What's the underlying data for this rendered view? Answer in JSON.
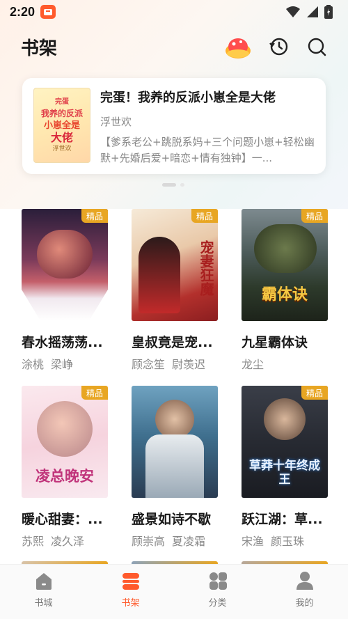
{
  "status_bar": {
    "time": "2:20"
  },
  "header": {
    "title": "书架",
    "icons": [
      "gift-icon",
      "history-icon",
      "search-icon"
    ]
  },
  "featured": {
    "title": "完蛋！我养的反派小崽全是大佬",
    "author": "浮世欢",
    "description": "【爹系老公+跳脱系妈+三个问题小崽+轻松幽默+先婚后爱+暗恋+情有独钟】一...",
    "cover_text": [
      "完蛋",
      "我养的反派",
      "小崽全是",
      "大佬"
    ],
    "cover_author": "浮世欢"
  },
  "badge_label": "精品",
  "books": [
    {
      "title": "春水摇荡荡...",
      "authors": [
        "涂桃",
        "梁峥"
      ],
      "badge": true
    },
    {
      "title": "皇叔竟是宠...",
      "authors": [
        "顾念笙",
        "尉羡迟"
      ],
      "badge": true,
      "cover_text": "宠妻狂魔"
    },
    {
      "title": "九星霸体诀",
      "authors": [
        "龙尘"
      ],
      "badge": true,
      "cover_text": "霸体诀"
    },
    {
      "title": "暖心甜妻：...",
      "authors": [
        "苏熙",
        "凌久泽"
      ],
      "badge": true,
      "cover_text": "凌总晚安"
    },
    {
      "title": "盛景如诗不歇",
      "authors": [
        "顾崇高",
        "夏凌霜"
      ],
      "badge": false
    },
    {
      "title": "跃江湖：草...",
      "authors": [
        "宋渔",
        "颜玉珠"
      ],
      "badge": true,
      "cover_text": "草莽十年终成王"
    }
  ],
  "tabs": [
    {
      "label": "书城",
      "icon": "home-icon",
      "active": false
    },
    {
      "label": "书架",
      "icon": "bookshelf-icon",
      "active": true
    },
    {
      "label": "分类",
      "icon": "category-icon",
      "active": false
    },
    {
      "label": "我的",
      "icon": "profile-icon",
      "active": false
    }
  ],
  "colors": {
    "accent": "#ff5a2c",
    "badge": "#e8a623"
  }
}
